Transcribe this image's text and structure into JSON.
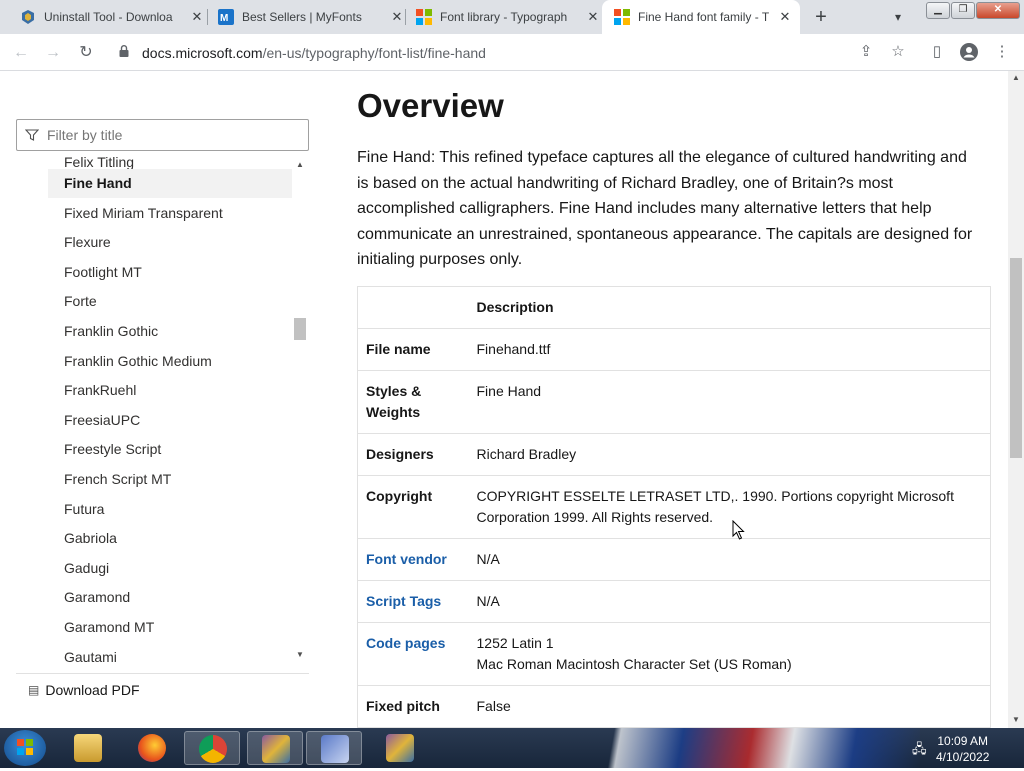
{
  "browser": {
    "tabs": [
      {
        "title": "Uninstall Tool - Downloa",
        "icon": "uninstall-tool-favicon"
      },
      {
        "title": "Best Sellers | MyFonts",
        "icon": "myfonts-favicon"
      },
      {
        "title": "Font library - Typograph",
        "icon": "microsoft-favicon"
      },
      {
        "title": "Fine Hand font family - T",
        "icon": "microsoft-favicon",
        "active": true
      }
    ],
    "url_host": "docs.microsoft.com",
    "url_path": "/en-us/typography/font-list/fine-hand"
  },
  "sidebar": {
    "filter_placeholder": "Filter by title",
    "items": [
      "Felix Titling",
      "Fine Hand",
      "Fixed Miriam Transparent",
      "Flexure",
      "Footlight MT",
      "Forte",
      "Franklin Gothic",
      "Franklin Gothic Medium",
      "FrankRuehl",
      "FreesiaUPC",
      "Freestyle Script",
      "French Script MT",
      "Futura",
      "Gabriola",
      "Gadugi",
      "Garamond",
      "Garamond MT",
      "Gautami"
    ],
    "selected_index": 1,
    "download_pdf": "Download PDF"
  },
  "main": {
    "heading": "Overview",
    "intro": "Fine Hand: This refined typeface captures all the elegance of cultured handwriting and is based on the actual handwriting of Richard Bradley, one of Britain?s most accomplished calligraphers. Fine Hand includes many alternative letters that help communicate an unrestrained, spontaneous appearance. The capitals are designed for initialing purposes only.",
    "table_header": "Description",
    "rows": [
      {
        "key": "File name",
        "value": "Finehand.ttf",
        "link": false
      },
      {
        "key": "Styles & Weights",
        "value": "Fine Hand",
        "link": false
      },
      {
        "key": "Designers",
        "value": "Richard Bradley",
        "link": false
      },
      {
        "key": "Copyright",
        "value": "COPYRIGHT ESSELTE LETRASET LTD,. 1990. Portions copyright Microsoft Corporation 1999. All Rights reserved.",
        "link": false
      },
      {
        "key": "Font vendor",
        "value": "N/A",
        "link": true
      },
      {
        "key": "Script Tags",
        "value": "N/A",
        "link": true
      },
      {
        "key": "Code pages",
        "value": "1252 Latin 1",
        "value2": "Mac Roman Macintosh Character Set (US Roman)",
        "link": true
      },
      {
        "key": "Fixed pitch",
        "value": "False",
        "link": false
      }
    ]
  },
  "taskbar": {
    "time": "10:09 AM",
    "date": "4/10/2022"
  },
  "colors": {
    "link": "#1a5ea8",
    "tabbar": "#dee1e6"
  }
}
